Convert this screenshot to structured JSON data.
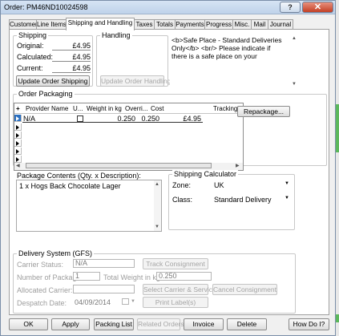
{
  "window": {
    "title": "Order: PM46ND10024598",
    "help_label": "?",
    "close_label": "✕"
  },
  "tabs": [
    {
      "label": "Customer"
    },
    {
      "label": "Line Items"
    },
    {
      "label": "Shipping and Handling"
    },
    {
      "label": "Taxes"
    },
    {
      "label": "Totals"
    },
    {
      "label": "Payments"
    },
    {
      "label": "Progress"
    },
    {
      "label": "Misc."
    },
    {
      "label": "Mail"
    },
    {
      "label": "Journal"
    }
  ],
  "shipping": {
    "title": "Shipping",
    "original_label": "Original:",
    "original_value": "£4.95",
    "calculated_label": "Calculated:",
    "calculated_value": "£4.95",
    "current_label": "Current:",
    "current_value": "£4.95",
    "update_button": "Update Order Shipping"
  },
  "handling": {
    "title": "Handling",
    "update_button": "Update Order Handling"
  },
  "notes": {
    "text": "<b>Safe Place - Standard Deliveries Only</b> <br/> Please indicate if there is a safe place on your"
  },
  "packaging": {
    "title": "Order Packaging",
    "add_label": "+",
    "columns": [
      "Provider Name",
      "U...",
      "Weight in kg",
      "Overri...",
      "Cost",
      "Tracking"
    ],
    "rows": [
      {
        "provider": "N/A",
        "weight": "0.250",
        "override": "0.250",
        "cost": "£4.95"
      }
    ],
    "repackage_button": "Repackage..."
  },
  "contents": {
    "title": "Package Contents (Qty. x Description):",
    "text": "1 x Hogs Back Chocolate Lager"
  },
  "calculator": {
    "title": "Shipping Calculator",
    "zone_label": "Zone:",
    "zone_value": "UK",
    "class_label": "Class:",
    "class_value": "Standard Delivery"
  },
  "delivery": {
    "title": "Delivery System (GFS)",
    "carrier_status_label": "Carrier Status:",
    "carrier_status_value": "N/A",
    "packages_label": "Number of Packages:",
    "packages_value": "1",
    "total_weight_label": "Total Weight in kg:",
    "total_weight_value": "0.250",
    "allocated_label": "Allocated Carrier:",
    "despatch_label": "Despatch Date:",
    "despatch_value": "04/09/2014",
    "track_button": "Track Consignment",
    "select_carrier_button": "Select Carrier & Service",
    "cancel_consignment_button": "Cancel Consignment",
    "print_labels_button": "Print Label(s)"
  },
  "footer": {
    "ok": "OK",
    "apply": "Apply",
    "packing_list": "Packing List",
    "related_orders": "Related Orders",
    "invoice": "Invoice",
    "delete": "Delete",
    "how_do_i": "How Do I?"
  },
  "colors": {
    "titlebar": "#cbdcf0",
    "close_button": "#c94a2f",
    "side_accent": "#5cb85c"
  }
}
